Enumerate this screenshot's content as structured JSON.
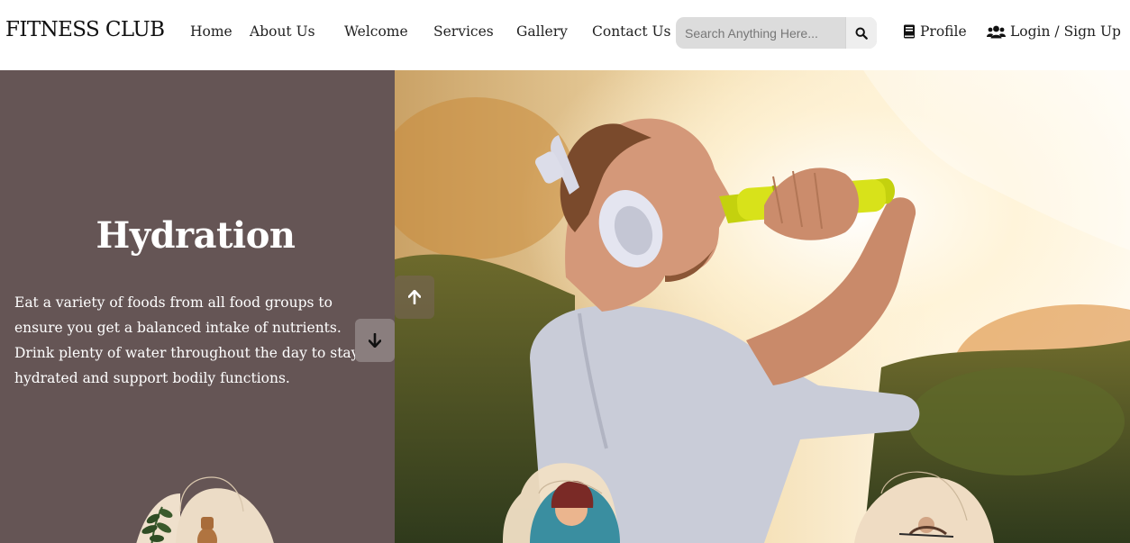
{
  "brand": "FITNESS CLUB",
  "nav": {
    "home": "Home",
    "about": "About Us",
    "welcome": "Welcome",
    "services": "Services",
    "gallery": "Gallery",
    "contact": "Contact Us"
  },
  "search": {
    "placeholder": "Search Anything Here..."
  },
  "account": {
    "profile": "Profile",
    "login": "Login / Sign Up"
  },
  "hero": {
    "title": "Hydration",
    "line1": "Eat a variety of foods from all food groups to ensure you get a balanced intake of nutrients.",
    "line2": "Drink plenty of water throughout the day to stay hydrated and support bodily functions."
  },
  "icons": {
    "search": "search-icon",
    "profile": "book-icon",
    "login": "users-icon",
    "up": "arrow-up-icon",
    "down": "arrow-down-icon"
  },
  "colors": {
    "panel": "#655555",
    "search_bg": "#dcdcdc",
    "text_light": "#ffffff"
  }
}
